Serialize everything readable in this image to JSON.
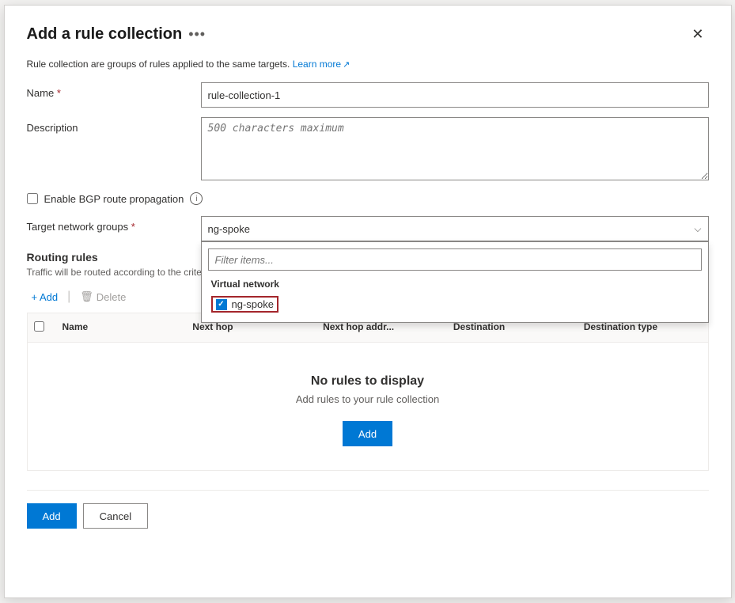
{
  "dialog": {
    "title": "Add a rule collection",
    "more_icon": "•••",
    "close_label": "✕"
  },
  "info": {
    "text": "Rule collection are groups of rules applied to the same targets.",
    "learn_more": "Learn more",
    "learn_more_icon": "↗"
  },
  "form": {
    "name_label": "Name",
    "name_required": "*",
    "name_value": "rule-collection-1",
    "description_label": "Description",
    "description_placeholder": "500 characters maximum",
    "bgp_label": "Enable BGP route propagation",
    "target_label": "Target network groups",
    "target_required": "*",
    "target_value": "ng-spoke",
    "filter_placeholder": "Filter items...",
    "virtual_network_section": "Virtual network",
    "ng_spoke_item": "ng-spoke"
  },
  "routing": {
    "title": "Routing rules",
    "subtitle": "Traffic will be routed according to the criteri",
    "toolbar": {
      "add_label": "+ Add",
      "divider": "|",
      "delete_label": "Delete",
      "delete_icon": "🗑"
    },
    "table": {
      "columns": [
        "Name",
        "Next hop",
        "Next hop addr...",
        "Destination",
        "Destination type"
      ],
      "empty_title": "No rules to display",
      "empty_subtitle": "Add rules to your rule collection",
      "add_label": "Add"
    }
  },
  "footer": {
    "add_label": "Add",
    "cancel_label": "Cancel"
  }
}
